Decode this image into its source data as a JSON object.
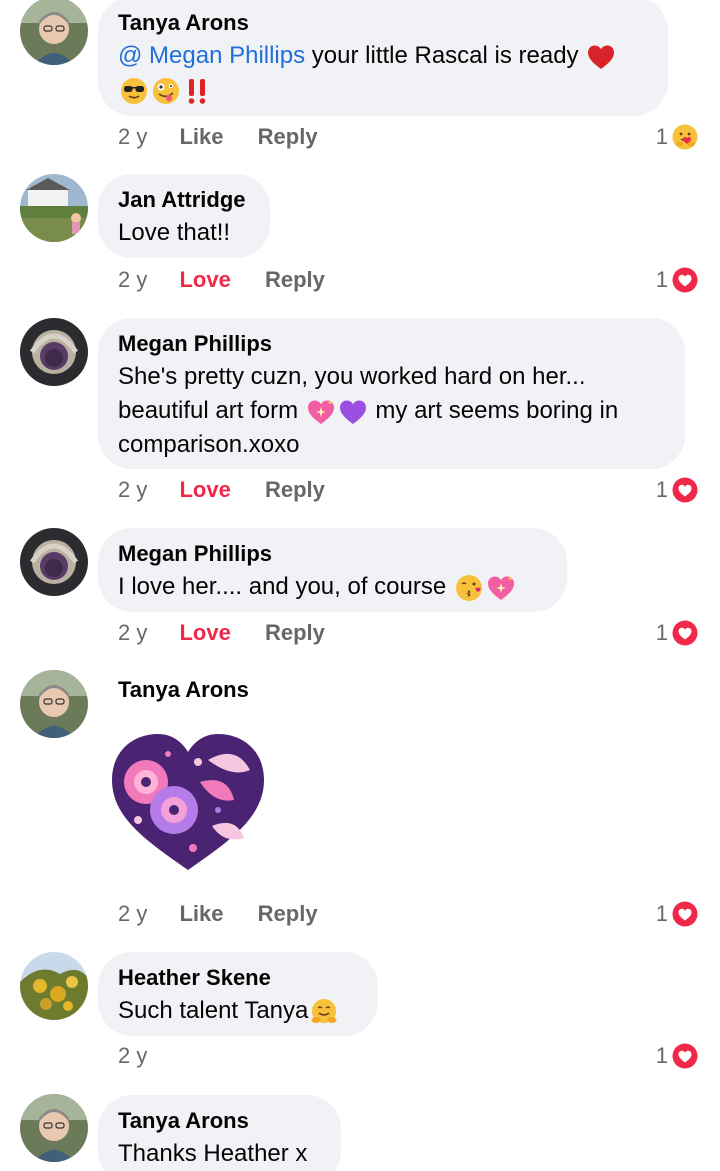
{
  "comments": [
    {
      "author": "Tanya Arons",
      "mention": "@ Megan Phillips",
      "text": " your little Rascal is ready ",
      "time": "2 y",
      "action": "Like",
      "reply": "Reply",
      "reaction_count": "1",
      "reaction_icon": "care-reaction-icon"
    },
    {
      "author": "Jan Attridge",
      "text": "Love that!!",
      "time": "2 y",
      "action": "Love",
      "reply": "Reply",
      "reaction_count": "1",
      "reaction_icon": "love-reaction-icon"
    },
    {
      "author": "Megan Phillips",
      "text_line1": "She's pretty cuzn, you worked hard on her...",
      "text_line2a": "beautiful art form ",
      "text_line2b": " my art seems boring in",
      "text_line3": "comparison.xoxo",
      "time": "2 y",
      "action": "Love",
      "reply": "Reply",
      "reaction_count": "1",
      "reaction_icon": "love-reaction-icon"
    },
    {
      "author": "Megan Phillips",
      "text": "I love her.... and you, of course ",
      "time": "2 y",
      "action": "Love",
      "reply": "Reply",
      "reaction_count": "1",
      "reaction_icon": "love-reaction-icon"
    },
    {
      "author": "Tanya Arons",
      "sticker": "floral-heart-sticker",
      "time": "2 y",
      "action": "Like",
      "reply": "Reply",
      "reaction_count": "1",
      "reaction_icon": "love-reaction-icon"
    },
    {
      "author": "Heather Skene",
      "text": "Such talent Tanya",
      "time": "2 y",
      "reaction_count": "1",
      "reaction_icon": "love-reaction-icon"
    },
    {
      "author": "Tanya Arons",
      "text": "Thanks Heather x"
    }
  ],
  "colors": {
    "bubble": "#f0f2f5",
    "mention": "#216fdb",
    "love": "#f0284a",
    "meta": "#65676b"
  }
}
